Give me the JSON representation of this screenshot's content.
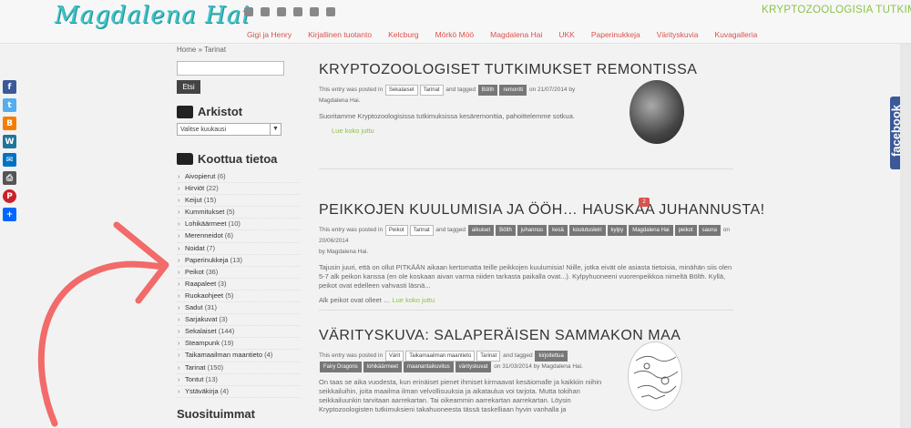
{
  "header": {
    "logo": "Magdalena Hai",
    "tagline": "KRYPTOZOOLOGISIA TUTKIMUKSIA",
    "social_icons": [
      "rss-icon",
      "twitter-icon",
      "facebook-icon",
      "youtube-icon",
      "pinterest-icon",
      "linkedin-icon"
    ],
    "nav": [
      "Gigi ja Henry",
      "Kirjallinen tuotanto",
      "Kelcburg",
      "Mörkö Möö",
      "Magdalena Hai",
      "UKK",
      "Paperinukkeja",
      "Värityskuvia",
      "Kuvagalleria"
    ]
  },
  "sharebar": {
    "icons": [
      "facebook-icon",
      "twitter-icon",
      "blogger-icon",
      "wordpress-icon",
      "email-icon",
      "print-icon",
      "pinterest-icon",
      "share-icon"
    ]
  },
  "fb_tab": "facebook",
  "sidebar": {
    "breadcrumb": "Home » Tarinat",
    "search_button": "Etsi",
    "archive_title": "Arkistot",
    "archive_select": "Valitse kuukausi",
    "categories_title": "Koottua tietoa",
    "categories": [
      {
        "name": "Aivopierut",
        "count": "(6)"
      },
      {
        "name": "Hirviöt",
        "count": "(22)"
      },
      {
        "name": "Keijut",
        "count": "(15)"
      },
      {
        "name": "Kummitukset",
        "count": "(5)"
      },
      {
        "name": "Lohikäärmeet",
        "count": "(10)"
      },
      {
        "name": "Merenneidot",
        "count": "(6)"
      },
      {
        "name": "Noidat",
        "count": "(7)"
      },
      {
        "name": "Paperinukkeja",
        "count": "(13)"
      },
      {
        "name": "Peikot",
        "count": "(36)"
      },
      {
        "name": "Raapaleet",
        "count": "(3)"
      },
      {
        "name": "Ruokaohjeet",
        "count": "(5)"
      },
      {
        "name": "Sadut",
        "count": "(31)"
      },
      {
        "name": "Sarjakuvat",
        "count": "(3)"
      },
      {
        "name": "Sekalaiset",
        "count": "(144)"
      },
      {
        "name": "Steampunk",
        "count": "(19)"
      },
      {
        "name": "Taikamaailman maantieto",
        "count": "(4)"
      },
      {
        "name": "Tarinat",
        "count": "(150)"
      },
      {
        "name": "Tontut",
        "count": "(13)"
      },
      {
        "name": "Ystäväkirja",
        "count": "(4)"
      }
    ],
    "popular_title": "Suosituimmat"
  },
  "posts": [
    {
      "title": "KRYPTOZOOLOGISET TUTKIMUKSET REMONTISSA",
      "meta_prefix": "This entry was posted in",
      "categories": [
        "Sekalaiset",
        "Tarinat"
      ],
      "meta_mid": "and tagged",
      "tags": [
        "Bölth",
        "remontti"
      ],
      "date_prefix": "on",
      "date": "21/07/2014",
      "by": "by",
      "author": "Magdalena Hai.",
      "excerpt": "Suoritamme Kryptozoologisissa tutkimuksissa kesäremonttia, pahoittelemme sotkua.",
      "readmore": "Lue koko juttu"
    },
    {
      "title": "PEIKKOJEN KUULUMISIA JA ÖÖH… HAUSKAA JUHANNUSTA!",
      "comments": "2",
      "meta_prefix": "This entry was posted in",
      "categories": [
        "Peikot",
        "Tarinat"
      ],
      "meta_mid": "and tagged",
      "tags": [
        "aikuiset",
        "Bölth",
        "juhannus",
        "kesä",
        "koulutusleiri",
        "kylpy",
        "Magdalena Hai",
        "peikot",
        "sauna"
      ],
      "date_prefix": "on",
      "date": "20/06/2014",
      "by": "by",
      "author": "Magdalena Hai.",
      "excerpt": "Tajusin juuri, että on ollut PITKÄÄN aikaan kertomatta teille peikkojen kuulumisia! Niille, jotka eivät ole asiasta tietoisia, minähän siis olen 5-7 alk peikon kanssa (en ole koskaan aivan varma niiden tarkasta paikalla ovat...). Kylpyhuoneeni vuorenpeikkoa nimeltä Bölth. Kyllä, peikot ovat edelleen vahvasti läsnä...",
      "excerpt2": "Alk peikot ovat olleet …",
      "readmore": "Lue koko juttu"
    },
    {
      "title": "VÄRITYSKUVA: SALAPERÄISEN SAMMAKON MAA",
      "meta_prefix": "This entry was posted in",
      "categories": [
        "Värit",
        "Taikamaailman maantieto",
        "Tarinat"
      ],
      "meta_mid": "and tagged",
      "tags": [
        "Fairy Dragons",
        "lohikäärmeet",
        "maanantaikuvitus",
        "värityskuvat"
      ],
      "tags_row1": [
        "kirjoitettua"
      ],
      "date_prefix": "on",
      "date": "31/03/2014",
      "by": "by",
      "author": "Magdalena Hai.",
      "excerpt": "On taas se aika vuodesta, kun erinäiset pienet ihmiset kirmaavat kesäiomalle ja kaikkiin niihin seikkailuihin, joita maailma ilman velvollisuuksia ja aikataulua voi tarjota. Mutta tokihan seikkailuunkin tarvitaan aarrekartan. Tai oikeammin aarrekartan aarrekartan. Löysin Kryptozoologisten tutkimuksieni takahuoneesta tässä taskelliaan hyvin vanhalla ja",
      "readmore": "Lue koko juttu"
    }
  ]
}
